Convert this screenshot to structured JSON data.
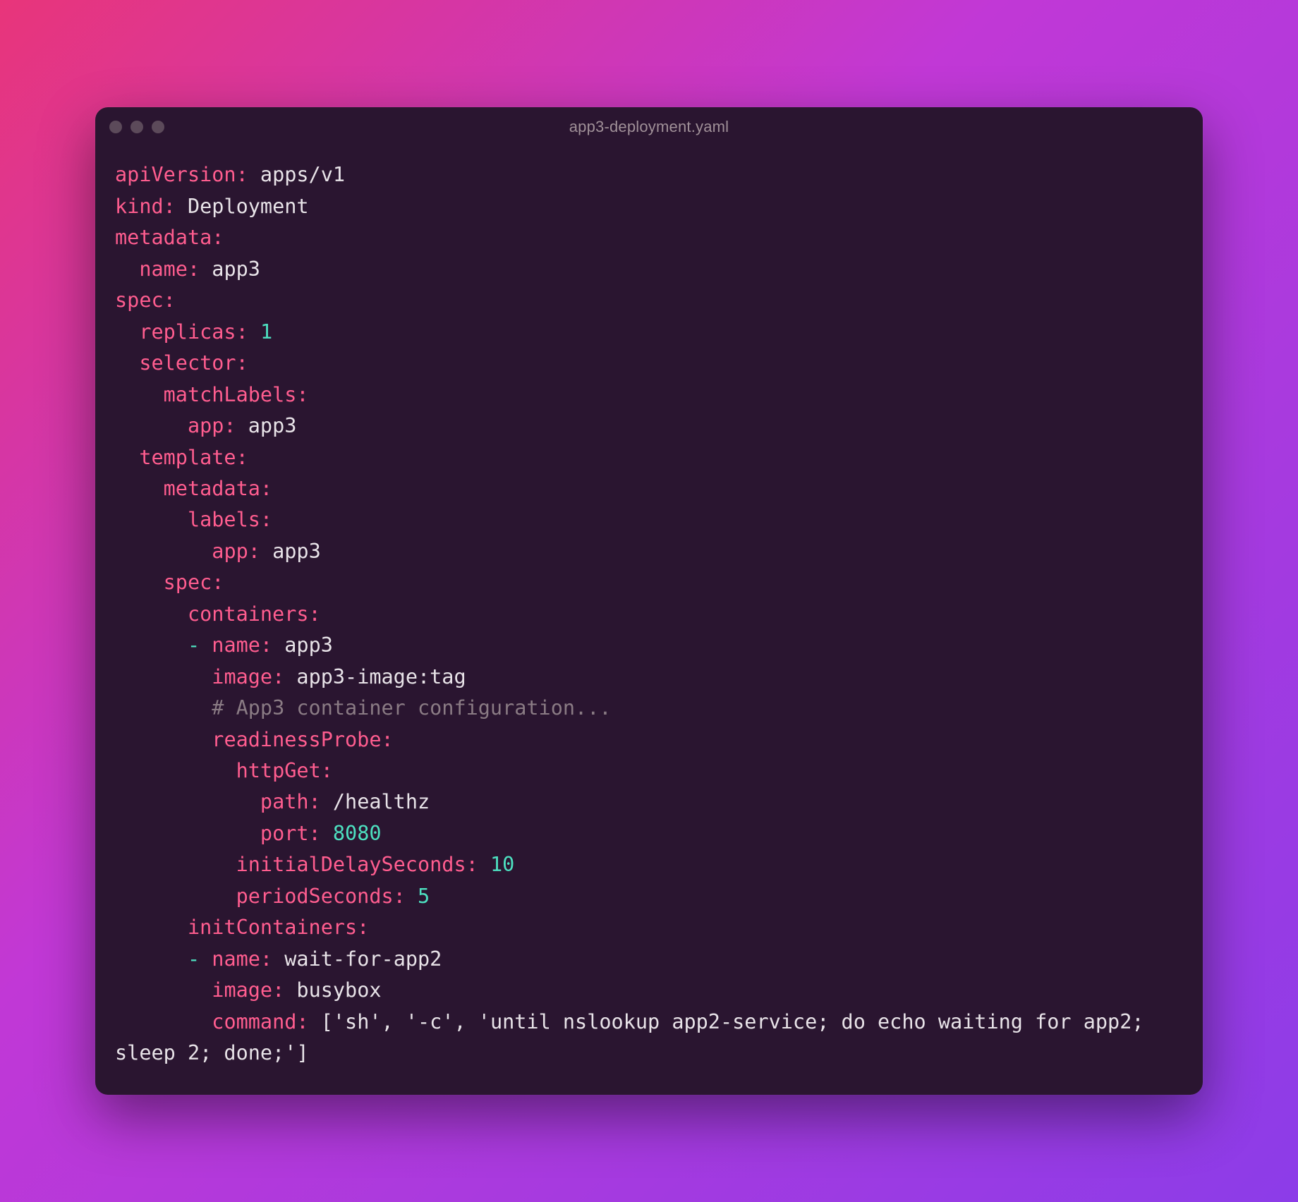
{
  "window": {
    "title": "app3-deployment.yaml"
  },
  "yaml": {
    "apiVersion_key": "apiVersion:",
    "apiVersion_val": "apps/v1",
    "kind_key": "kind:",
    "kind_val": "Deployment",
    "metadata_key": "metadata:",
    "metadata_name_key": "name:",
    "metadata_name_val": "app3",
    "spec_key": "spec:",
    "replicas_key": "replicas:",
    "replicas_val": "1",
    "selector_key": "selector:",
    "matchLabels_key": "matchLabels:",
    "ml_app_key": "app:",
    "ml_app_val": "app3",
    "template_key": "template:",
    "t_metadata_key": "metadata:",
    "labels_key": "labels:",
    "l_app_key": "app:",
    "l_app_val": "app3",
    "t_spec_key": "spec:",
    "containers_key": "containers:",
    "dash1": "-",
    "c_name_key": "name:",
    "c_name_val": "app3",
    "c_image_key": "image:",
    "c_image_val": "app3-image:tag",
    "comment": "# App3 container configuration...",
    "readinessProbe_key": "readinessProbe:",
    "httpGet_key": "httpGet:",
    "path_key": "path:",
    "path_val": "/healthz",
    "port_key": "port:",
    "port_val": "8080",
    "ids_key": "initialDelaySeconds:",
    "ids_val": "10",
    "ps_key": "periodSeconds:",
    "ps_val": "5",
    "initContainers_key": "initContainers:",
    "dash2": "-",
    "ic_name_key": "name:",
    "ic_name_val": "wait-for-app2",
    "ic_image_key": "image:",
    "ic_image_val": "busybox",
    "command_key": "command:",
    "command_val": "['sh', '-c', 'until nslookup app2-service; do echo waiting for app2; sleep 2; done;']"
  }
}
